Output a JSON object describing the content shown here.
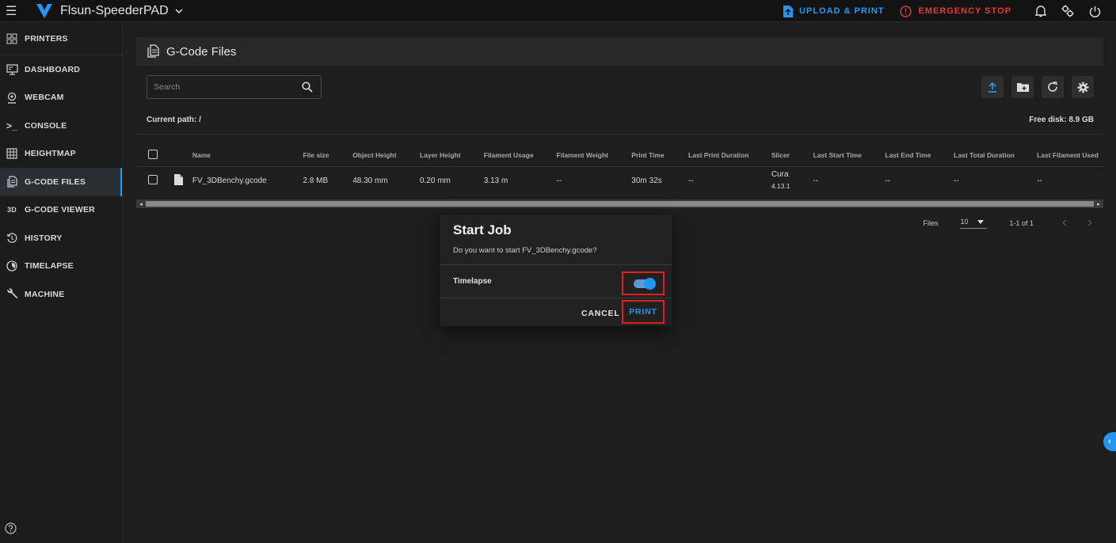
{
  "app": {
    "printer_name": "Flsun-SpeederPAD",
    "upload_print_label": "UPLOAD & PRINT",
    "emergency_stop_label": "EMERGENCY STOP",
    "accent_color": "#2196f3",
    "danger_color": "#e53935"
  },
  "sidebar": {
    "items": [
      {
        "label": "PRINTERS",
        "icon": "grid-icon"
      },
      {
        "label": "DASHBOARD",
        "icon": "monitor-icon"
      },
      {
        "label": "WEBCAM",
        "icon": "webcam-icon"
      },
      {
        "label": "CONSOLE",
        "icon": "console-icon"
      },
      {
        "label": "HEIGHTMAP",
        "icon": "heightmap-icon"
      },
      {
        "label": "G-CODE FILES",
        "icon": "file-icon",
        "active": true
      },
      {
        "label": "G-CODE VIEWER",
        "icon": "3d-icon",
        "prefix": "3D"
      },
      {
        "label": "HISTORY",
        "icon": "history-icon"
      },
      {
        "label": "TIMELAPSE",
        "icon": "timelapse-icon"
      },
      {
        "label": "MACHINE",
        "icon": "wrench-icon"
      }
    ]
  },
  "files": {
    "title": "G-Code Files",
    "search_placeholder": "Search",
    "current_path_label": "Current path: /",
    "free_disk_label": "Free disk: 8.9 GB",
    "columns": [
      "Name",
      "File size",
      "Object Height",
      "Layer Height",
      "Filament Usage",
      "Filament Weight",
      "Print Time",
      "Last Print Duration",
      "Slicer",
      "Last Start Time",
      "Last End Time",
      "Last Total Duration",
      "Last Filament Used"
    ],
    "rows": [
      {
        "name": "FV_3DBenchy.gcode",
        "file_size": "2.8 MB",
        "object_height": "48.30 mm",
        "layer_height": "0.20 mm",
        "filament_usage": "3.13 m",
        "filament_weight": "--",
        "print_time": "30m 32s",
        "last_print_duration": "--",
        "slicer": "Cura",
        "slicer_version": "4.13.1",
        "last_start_time": "--",
        "last_end_time": "--",
        "last_total_duration": "--",
        "last_filament_used": "--"
      }
    ],
    "footer": {
      "files_label": "Files",
      "per_page": "10",
      "range": "1-1 of 1"
    }
  },
  "dialog": {
    "title": "Start Job",
    "message": "Do you want to start FV_3DBenchy.gcode?",
    "timelapse_label": "Timelapse",
    "timelapse_on": true,
    "cancel_label": "CANCEL",
    "print_label": "PRINT"
  }
}
